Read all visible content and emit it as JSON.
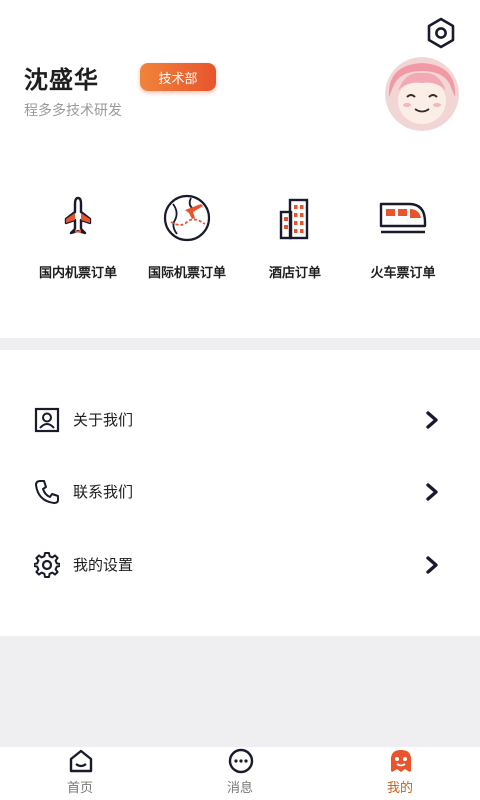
{
  "profile": {
    "name": "沈盛华",
    "department_badge": "技术部",
    "company": "程多多技术研发"
  },
  "orders": [
    {
      "label": "国内机票订单",
      "icon": "airplane-icon"
    },
    {
      "label": "国际机票订单",
      "icon": "globe-airplane-icon"
    },
    {
      "label": "酒店订单",
      "icon": "building-icon"
    },
    {
      "label": "火车票订单",
      "icon": "train-icon"
    }
  ],
  "menu": [
    {
      "label": "关于我们",
      "icon": "user-card-icon"
    },
    {
      "label": "联系我们",
      "icon": "phone-icon"
    },
    {
      "label": "我的设置",
      "icon": "gear-icon"
    }
  ],
  "tabs": [
    {
      "label": "首页",
      "icon": "home-icon",
      "active": false
    },
    {
      "label": "消息",
      "icon": "message-icon",
      "active": false
    },
    {
      "label": "我的",
      "icon": "profile-icon",
      "active": true
    }
  ],
  "colors": {
    "accent": "#e8542c",
    "accent_light": "#f0833b",
    "dark": "#1a1a2e",
    "active_tab": "#c4631f",
    "section_bg": "#efeff1"
  }
}
